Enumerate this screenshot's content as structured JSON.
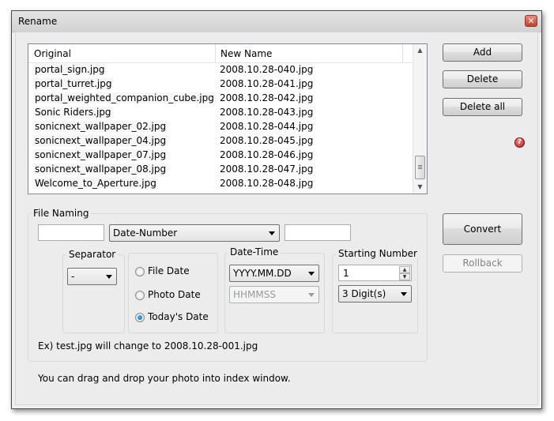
{
  "window": {
    "title": "Rename",
    "close_glyph": "✕"
  },
  "list": {
    "columns": [
      "Original",
      "New Name"
    ],
    "rows": [
      {
        "original": "portal_sign.jpg",
        "new_name": "2008.10.28-040.jpg"
      },
      {
        "original": "portal_turret.jpg",
        "new_name": "2008.10.28-041.jpg"
      },
      {
        "original": "portal_weighted_companion_cube.jpg",
        "new_name": "2008.10.28-042.jpg"
      },
      {
        "original": "Sonic Riders.jpg",
        "new_name": "2008.10.28-043.jpg"
      },
      {
        "original": "sonicnext_wallpaper_02.jpg",
        "new_name": "2008.10.28-044.jpg"
      },
      {
        "original": "sonicnext_wallpaper_04.jpg",
        "new_name": "2008.10.28-045.jpg"
      },
      {
        "original": "sonicnext_wallpaper_07.jpg",
        "new_name": "2008.10.28-046.jpg"
      },
      {
        "original": "sonicnext_wallpaper_08.jpg",
        "new_name": "2008.10.28-047.jpg"
      },
      {
        "original": "Welcome_to_Aperture.jpg",
        "new_name": "2008.10.28-048.jpg"
      }
    ]
  },
  "buttons": {
    "add": "Add",
    "delete": "Delete",
    "delete_all": "Delete all",
    "convert": "Convert",
    "rollback": "Rollback",
    "help_glyph": "?"
  },
  "file_naming": {
    "label": "File Naming",
    "prefix_value": "",
    "mode": "Date-Number",
    "suffix_value": "",
    "separator": {
      "label": "Separator",
      "value": "-"
    },
    "date_source": {
      "options": [
        "File Date",
        "Photo Date",
        "Today's Date"
      ],
      "selected": "Today's Date"
    },
    "date_time": {
      "label": "Date-Time",
      "date_format": "YYYY.MM.DD",
      "time_format": "HHMMSS"
    },
    "starting_number": {
      "label": "Starting Number",
      "value": "1",
      "digits": "3 Digit(s)"
    },
    "example": "Ex) test.jpg will change to 2008.10.28-001.jpg"
  },
  "hint": "You can drag and drop your photo into index window."
}
